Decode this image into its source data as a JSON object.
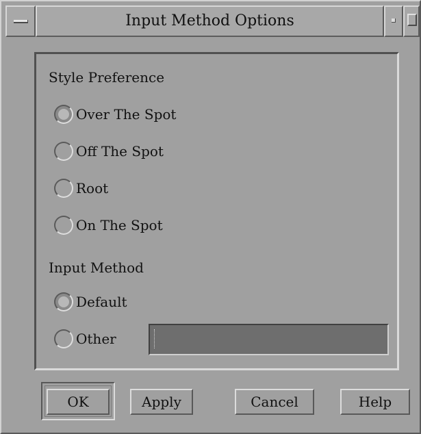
{
  "window": {
    "title": "Input Method Options"
  },
  "style_preference": {
    "label": "Style Preference",
    "options": [
      {
        "label": "Over The Spot",
        "checked": true
      },
      {
        "label": "Off The Spot",
        "checked": false
      },
      {
        "label": "Root",
        "checked": false
      },
      {
        "label": "On The Spot",
        "checked": false
      }
    ]
  },
  "input_method": {
    "label": "Input Method",
    "options": [
      {
        "label": "Default",
        "checked": true
      },
      {
        "label": "Other",
        "checked": false
      }
    ],
    "other_value": ""
  },
  "buttons": {
    "ok": "OK",
    "apply": "Apply",
    "cancel": "Cancel",
    "help": "Help"
  },
  "icons": {
    "window_menu": "window-menu-icon",
    "minimize": "minimize-icon",
    "maximize": "maximize-icon"
  },
  "colors": {
    "background": "#a0a0a0",
    "input_field": "#6e6e6e"
  }
}
